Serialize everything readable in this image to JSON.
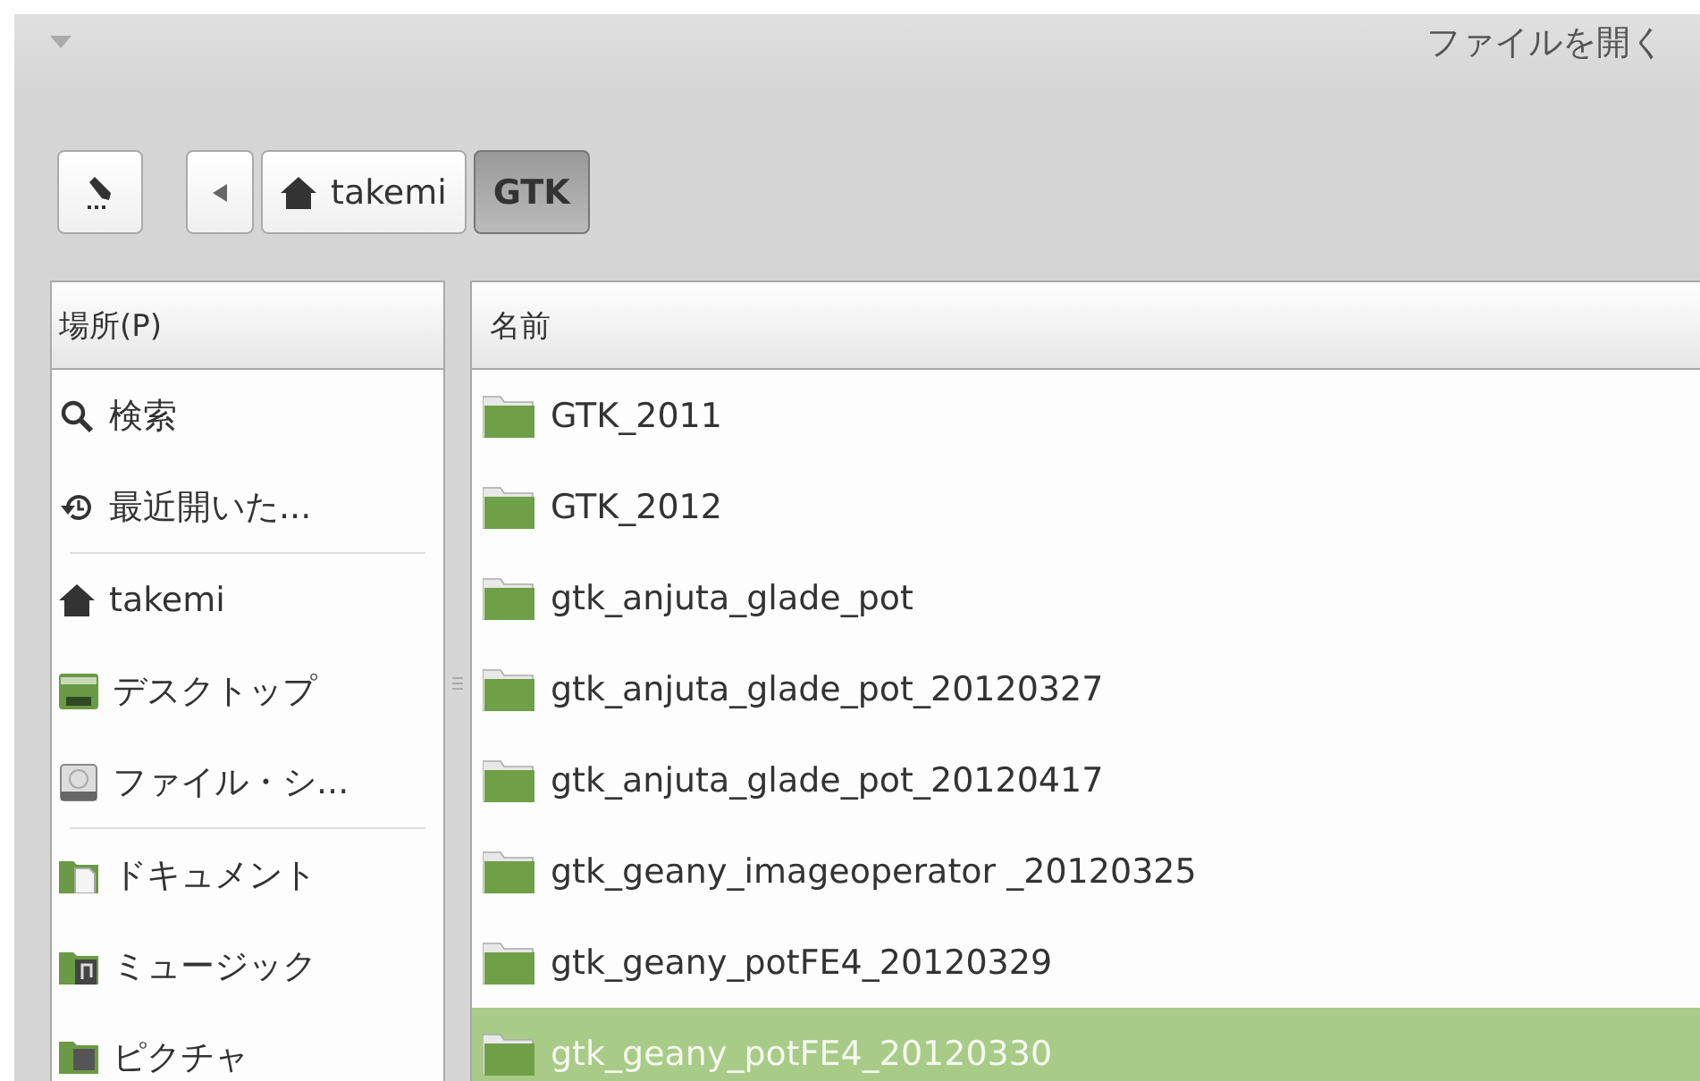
{
  "window": {
    "title": "ファイルを開く"
  },
  "path_bar": {
    "buttons": [
      {
        "label": "takemi",
        "kind": "home",
        "selected": false
      },
      {
        "label": "GTK",
        "kind": "folder",
        "selected": true
      }
    ]
  },
  "places": {
    "header": "場所(P)",
    "groups": [
      [
        {
          "label": "検索",
          "kind": "search"
        },
        {
          "label": "最近開いた...",
          "kind": "recent"
        }
      ],
      [
        {
          "label": "takemi",
          "kind": "home"
        },
        {
          "label": "デスクトップ",
          "kind": "desktop"
        },
        {
          "label": "ファイル・シ...",
          "kind": "drive"
        }
      ],
      [
        {
          "label": "ドキュメント",
          "kind": "documents"
        },
        {
          "label": "ミュージック",
          "kind": "music"
        },
        {
          "label": "ピクチャ",
          "kind": "pictures"
        }
      ]
    ]
  },
  "files": {
    "column": "名前",
    "rows": [
      {
        "name": "GTK_2011",
        "selected": false
      },
      {
        "name": "GTK_2012",
        "selected": false
      },
      {
        "name": "gtk_anjuta_glade_pot",
        "selected": false
      },
      {
        "name": "gtk_anjuta_glade_pot_20120327",
        "selected": false
      },
      {
        "name": "gtk_anjuta_glade_pot_20120417",
        "selected": false
      },
      {
        "name": "gtk_geany_imageoperator _20120325",
        "selected": false
      },
      {
        "name": "gtk_geany_potFE4_20120329",
        "selected": false
      },
      {
        "name": "gtk_geany_potFE4_20120330",
        "selected": true
      }
    ]
  }
}
